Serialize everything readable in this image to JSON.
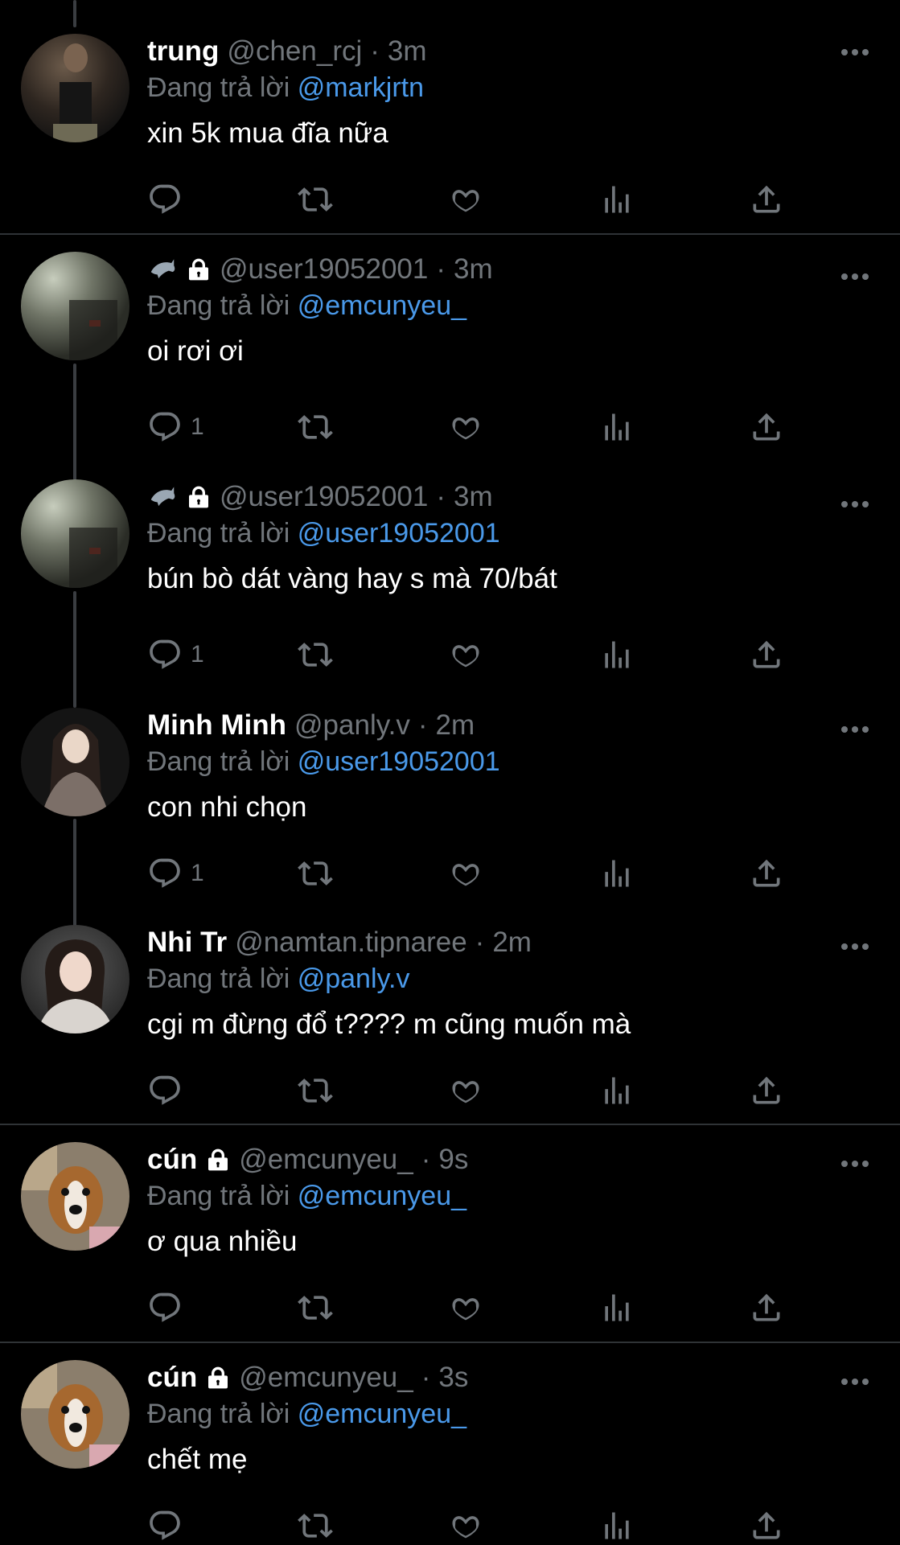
{
  "reply_prefix": "Đang trả lời",
  "tweets": [
    {
      "name": "trung",
      "handle": "@chen_rcj",
      "sep": "·",
      "time": "3m",
      "reply_to": "@markjrtn",
      "text": "xin 5k mua đĩa nữa",
      "replies": ""
    },
    {
      "name": "",
      "handle": "@user19052001",
      "sep": "·",
      "time": "3m",
      "reply_to": "@emcunyeu_",
      "text": "oi rơi ơi",
      "replies": "1"
    },
    {
      "name": "",
      "handle": "@user19052001",
      "sep": "·",
      "time": "3m",
      "reply_to": "@user19052001",
      "text": "bún bò dát vàng hay s mà 70/bát",
      "replies": "1"
    },
    {
      "name": "Minh Minh",
      "handle": "@panly.v",
      "sep": "·",
      "time": "2m",
      "reply_to": "@user19052001",
      "text": "con nhi chọn",
      "replies": "1"
    },
    {
      "name": "Nhi Tr",
      "handle": "@namtan.tipnaree",
      "sep": "·",
      "time": "2m",
      "reply_to": "@panly.v",
      "text": "cgi m đừng đổ t???? m cũng muốn mà",
      "replies": ""
    },
    {
      "name": "cún",
      "handle": "@emcunyeu_",
      "sep": "·",
      "time": "9s",
      "reply_to": "@emcunyeu_",
      "text": "ơ qua nhiều",
      "replies": ""
    },
    {
      "name": "cún",
      "handle": "@emcunyeu_",
      "sep": "·",
      "time": "3s",
      "reply_to": "@emcunyeu_",
      "text": "chết mẹ",
      "replies": ""
    }
  ],
  "colors": {
    "background": "#000000",
    "text": "#ffffff",
    "muted": "#71767b",
    "link": "#4a99e9",
    "divider": "#2f3336"
  },
  "icons": [
    "reply-icon",
    "retweet-icon",
    "like-icon",
    "views-icon",
    "share-icon",
    "more-icon",
    "lock-icon",
    "dolphin-icon"
  ]
}
